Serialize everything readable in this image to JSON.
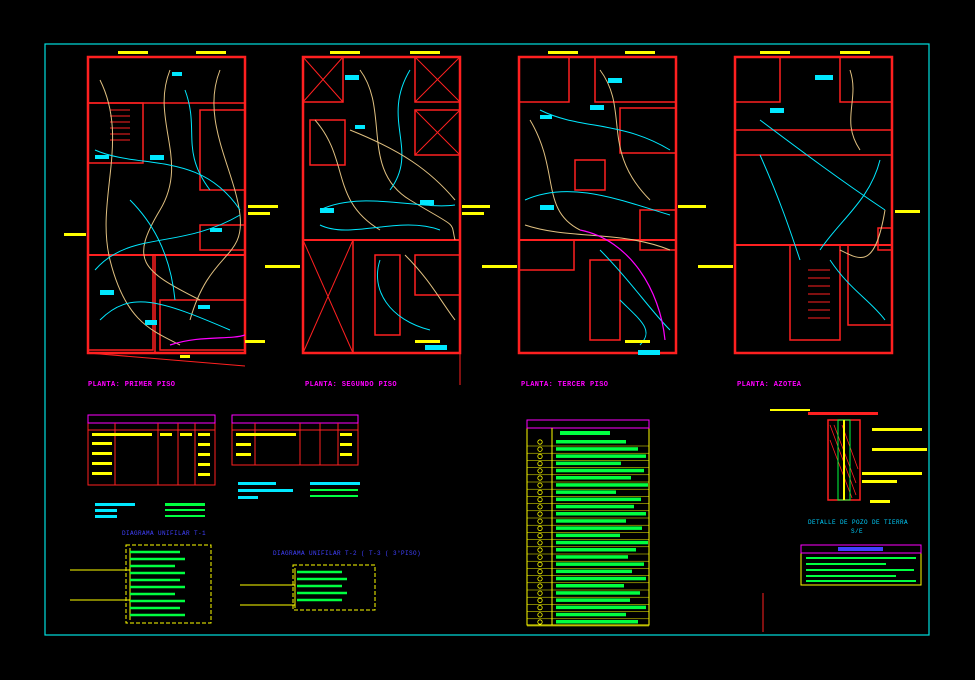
{
  "colors": {
    "background": "#000000",
    "frame": "#00e0e0",
    "walls": "#ff2020",
    "wiring_cyan": "#00e8ff",
    "wiring_tan": "#e0c080",
    "text_magenta": "#ff00ff",
    "labels_yellow": "#ffff00",
    "legend_green": "#00ff40"
  },
  "plans": [
    {
      "title": "PLANTA: PRIMER PISO"
    },
    {
      "title": "PLANTA: SEGUNDO PISO"
    },
    {
      "title": "PLANTA: TERCER PISO"
    },
    {
      "title": "PLANTA: AZOTEA"
    }
  ],
  "diagrams": {
    "unifilar_1": "DIAGRAMA UNIFILAR T-1",
    "unifilar_2": "DIAGRAMA UNIFILAR T-2 ( T-3 ( 3°PISO)",
    "detalle_pozo": "DETALLE DE POZO DE TIERRA",
    "detalle_escala": "S/E"
  },
  "icons": {
    "legend_symbols": "electrical-symbol-icon",
    "ground_rod": "ground-rod-icon"
  }
}
